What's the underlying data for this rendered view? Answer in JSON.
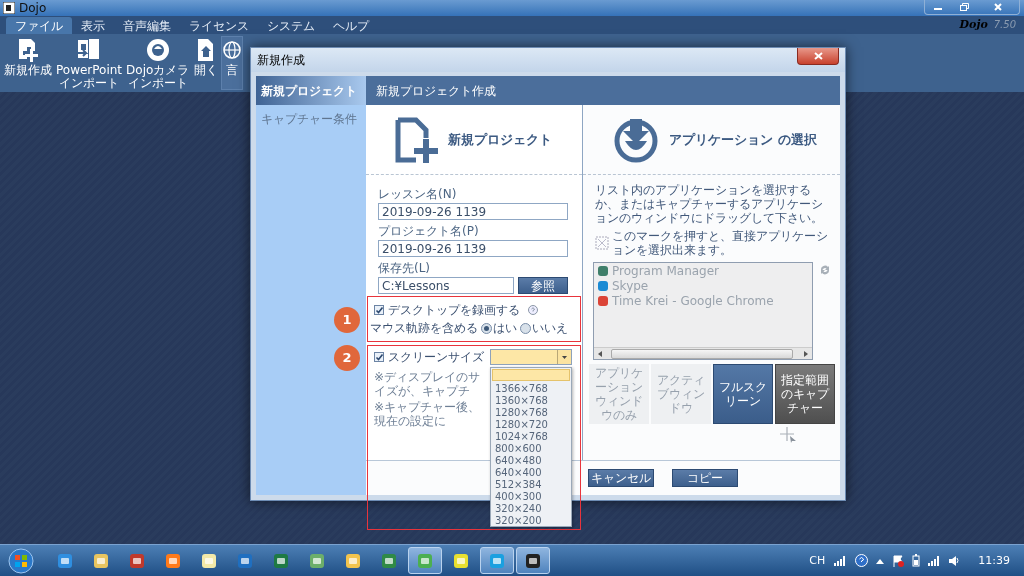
{
  "app": {
    "title": "Dojo",
    "logo": "Dojo",
    "version": "7.50"
  },
  "menu_tabs": [
    {
      "label": "ファイル",
      "selected": true
    },
    {
      "label": "表示",
      "selected": false
    },
    {
      "label": "音声編集",
      "selected": false
    },
    {
      "label": "ライセンス",
      "selected": false
    },
    {
      "label": "システム",
      "selected": false
    },
    {
      "label": "ヘルプ",
      "selected": false
    }
  ],
  "ribbon": [
    {
      "lines": [
        "新規作成"
      ],
      "kind": "new",
      "selected": false
    },
    {
      "lines": [
        "PowerPoint",
        "インポート"
      ],
      "kind": "import",
      "selected": false
    },
    {
      "lines": [
        "Dojoカメラ",
        "インポート"
      ],
      "kind": "camera",
      "selected": false
    },
    {
      "lines": [
        "開く"
      ],
      "kind": "open",
      "selected": false
    },
    {
      "lines": [
        "言"
      ],
      "kind": "globe",
      "selected": true
    }
  ],
  "dialog": {
    "title": "新規作成",
    "sidebar": [
      {
        "label": "新規プロジェクト",
        "selected": true
      },
      {
        "label": "キャプチャー条件",
        "selected": false
      }
    ],
    "header": "新規プロジェクト作成",
    "new_project": {
      "title": "新規プロジェクト",
      "fields": [
        {
          "label": "レッスン名(N)",
          "value": "2019-09-26 1139"
        },
        {
          "label": "プロジェクト名(P)",
          "value": "2019-09-26 1139"
        },
        {
          "label": "保存先(L)",
          "value": "C:¥Lessons",
          "button": "参照"
        }
      ],
      "record_desktop": {
        "label": "デスクトップを録画する",
        "checked": true
      },
      "mouse_trail": {
        "label": "マウス軌跡を含める",
        "options": [
          {
            "label": "はい",
            "selected": true
          },
          {
            "label": "いいえ",
            "selected": false
          }
        ]
      },
      "screen_size": {
        "label": "スクリーンサイズ",
        "checked": true,
        "notes": [
          "※ディスプレイのサイズが、キャプチ",
          "※キャプチャー後、現在の設定に"
        ],
        "options": [
          "1366×768",
          "1360×768",
          "1280×768",
          "1280×720",
          "1024×768",
          "800×600",
          "640×480",
          "640×400",
          "512×384",
          "400×300",
          "320×240",
          "320×200"
        ]
      }
    },
    "app_select": {
      "title": "アプリケーション の選択",
      "instructions": "リスト内のアプリケーションを選択するか、またはキャプチャーするアプリケーションのウィンドウにドラッグして下さい。",
      "marker_hint": "このマークを押すと、直接アプリケーションを選択出来ます。",
      "apps": [
        {
          "name": "Program Manager",
          "color": "#3f7f6a"
        },
        {
          "name": "Skype",
          "color": "#1a8ad4"
        },
        {
          "name": "Time Krei - Google Chrome",
          "color": "#db4437"
        }
      ],
      "modes": [
        {
          "label": "アプリケーションウィンドウのみ",
          "selected": false,
          "disabled": true
        },
        {
          "label": "アクティブウィンドウ",
          "selected": false,
          "disabled": true
        },
        {
          "label": "フルスクリーン",
          "selected": true,
          "disabled": false
        },
        {
          "label": "指定範囲のキャプチャー",
          "selected": false,
          "disabled": false
        }
      ]
    },
    "footer_buttons": [
      "キャンセル",
      "コピー"
    ]
  },
  "annotations": [
    {
      "number": "1"
    },
    {
      "number": "2"
    }
  ],
  "taskbar": {
    "apps": [
      {
        "color": "#2f8fe0",
        "active": false
      },
      {
        "color": "#e8c560",
        "active": false
      },
      {
        "color": "#c0392b",
        "active": false
      },
      {
        "color": "#ff7a1a",
        "active": false
      },
      {
        "color": "#f3e9a8",
        "active": false
      },
      {
        "color": "#1f6fc0",
        "active": false
      },
      {
        "color": "#1e7a44",
        "active": false
      },
      {
        "color": "#6cae6a",
        "active": false
      },
      {
        "color": "#f2c44e",
        "active": false
      },
      {
        "color": "#2f8a46",
        "active": false
      },
      {
        "color": "#4caf50",
        "active": true
      },
      {
        "color": "#e8e030",
        "active": false
      },
      {
        "color": "#1aa0e0",
        "active": true
      },
      {
        "color": "#222222",
        "active": true
      }
    ],
    "language": "CH",
    "time": "11:39"
  }
}
